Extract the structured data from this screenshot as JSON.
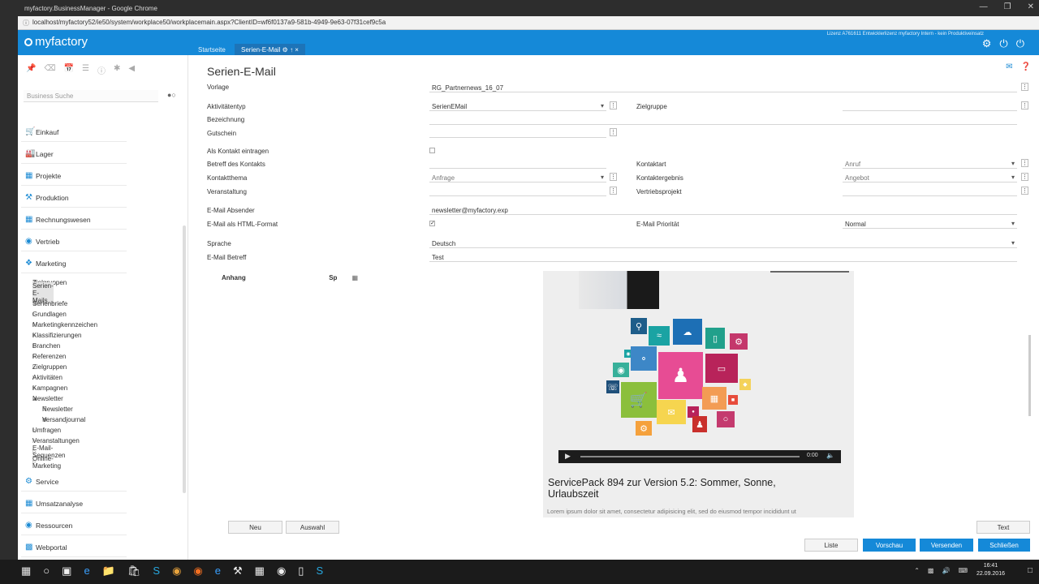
{
  "browser": {
    "title": "myfactory.BusinessManager - Google Chrome",
    "url": "localhost/myfactory52/ie50/system/workplace50/workplacemain.aspx?ClientID=wf6f0137a9-581b-4949-9e63-07f31cef9c5a"
  },
  "header": {
    "logo": "myfactory",
    "tabs": [
      {
        "label": "Startseite"
      },
      {
        "label": "Serien-E-Mail ⚙ ↑ ×"
      }
    ],
    "license": "Lizenz A761611 Entwicklerlizenz myfactory Intern - kein Produktiveinsatz"
  },
  "sidebar": {
    "search_placeholder": "Business Suche",
    "main_items": [
      {
        "label": "Einkauf"
      },
      {
        "label": "Lager"
      },
      {
        "label": "Projekte"
      },
      {
        "label": "Produktion"
      },
      {
        "label": "Rechnungswesen"
      },
      {
        "label": "Vertrieb"
      },
      {
        "label": "Marketing"
      }
    ],
    "sub_items": [
      {
        "label": "Zielgruppen"
      },
      {
        "label": "Serien-E-Mails"
      },
      {
        "label": "Serienbriefe"
      },
      {
        "label": "Grundlagen"
      },
      {
        "label": "Marketingkennzeichen"
      },
      {
        "label": "Klassifizierungen"
      },
      {
        "label": "Branchen"
      },
      {
        "label": "Referenzen"
      },
      {
        "label": "Zielgruppen"
      },
      {
        "label": "Aktivitäten"
      },
      {
        "label": "Kampagnen"
      },
      {
        "label": "Newsletter"
      },
      {
        "label": "Newsletter"
      },
      {
        "label": "Versandjournal"
      },
      {
        "label": "Umfragen"
      },
      {
        "label": "Veranstaltungen"
      },
      {
        "label": "E-Mail-Sequenzen"
      },
      {
        "label": "Online-Marketing"
      }
    ],
    "bottom_items": [
      {
        "label": "Service"
      },
      {
        "label": "Umsatzanalyse"
      },
      {
        "label": "Ressourcen"
      },
      {
        "label": "Webportal"
      }
    ]
  },
  "form": {
    "title": "Serien-E-Mail",
    "vorlage_label": "Vorlage",
    "vorlage_value": "RG_Partnernews_16_07",
    "aktivitaetentyp_label": "Aktivitätentyp",
    "aktivitaetentyp_value": "SerienEMail",
    "zielgruppe_label": "Zielgruppe",
    "bezeichnung_label": "Bezeichnung",
    "gutschein_label": "Gutschein",
    "als_kontakt_label": "Als Kontakt eintragen",
    "betreff_kontakt_label": "Betreff des Kontakts",
    "kontaktart_label": "Kontaktart",
    "kontaktart_value": "Anruf",
    "kontaktthema_label": "Kontaktthema",
    "kontaktthema_value": "Anfrage",
    "kontaktergebnis_label": "Kontaktergebnis",
    "kontaktergebnis_value": "Angebot",
    "veranstaltung_label": "Veranstaltung",
    "vertriebsprojekt_label": "Vertriebsprojekt",
    "absender_label": "E-Mail Absender",
    "absender_value": "newsletter@myfactory.exp",
    "html_label": "E-Mail als HTML-Format",
    "prioritaet_label": "E-Mail Priorität",
    "prioritaet_value": "Normal",
    "sprache_label": "Sprache",
    "sprache_value": "Deutsch",
    "betreff_label": "E-Mail Betreff",
    "betreff_value": "Test",
    "anhang_header": "Anhang",
    "sp_header": "Sp"
  },
  "preview": {
    "player_time": "0:00",
    "headline": "ServicePack 894 zur Version 5.2: Sommer, Sonne, Urlaubszeit",
    "body": "Lorem ipsum dolor sit amet, consectetur adipisicing elit, sed do eiusmod tempor incididunt ut"
  },
  "buttons": {
    "neu": "Neu",
    "auswahl": "Auswahl",
    "text": "Text",
    "liste": "Liste",
    "vorschau": "Vorschau",
    "versenden": "Versenden",
    "schliessen": "Schließen"
  },
  "taskbar": {
    "time": "16:41",
    "date": "22.09.2016"
  },
  "colors": {
    "brand_blue": "#1589d8",
    "tab_active": "#1d74b8"
  }
}
